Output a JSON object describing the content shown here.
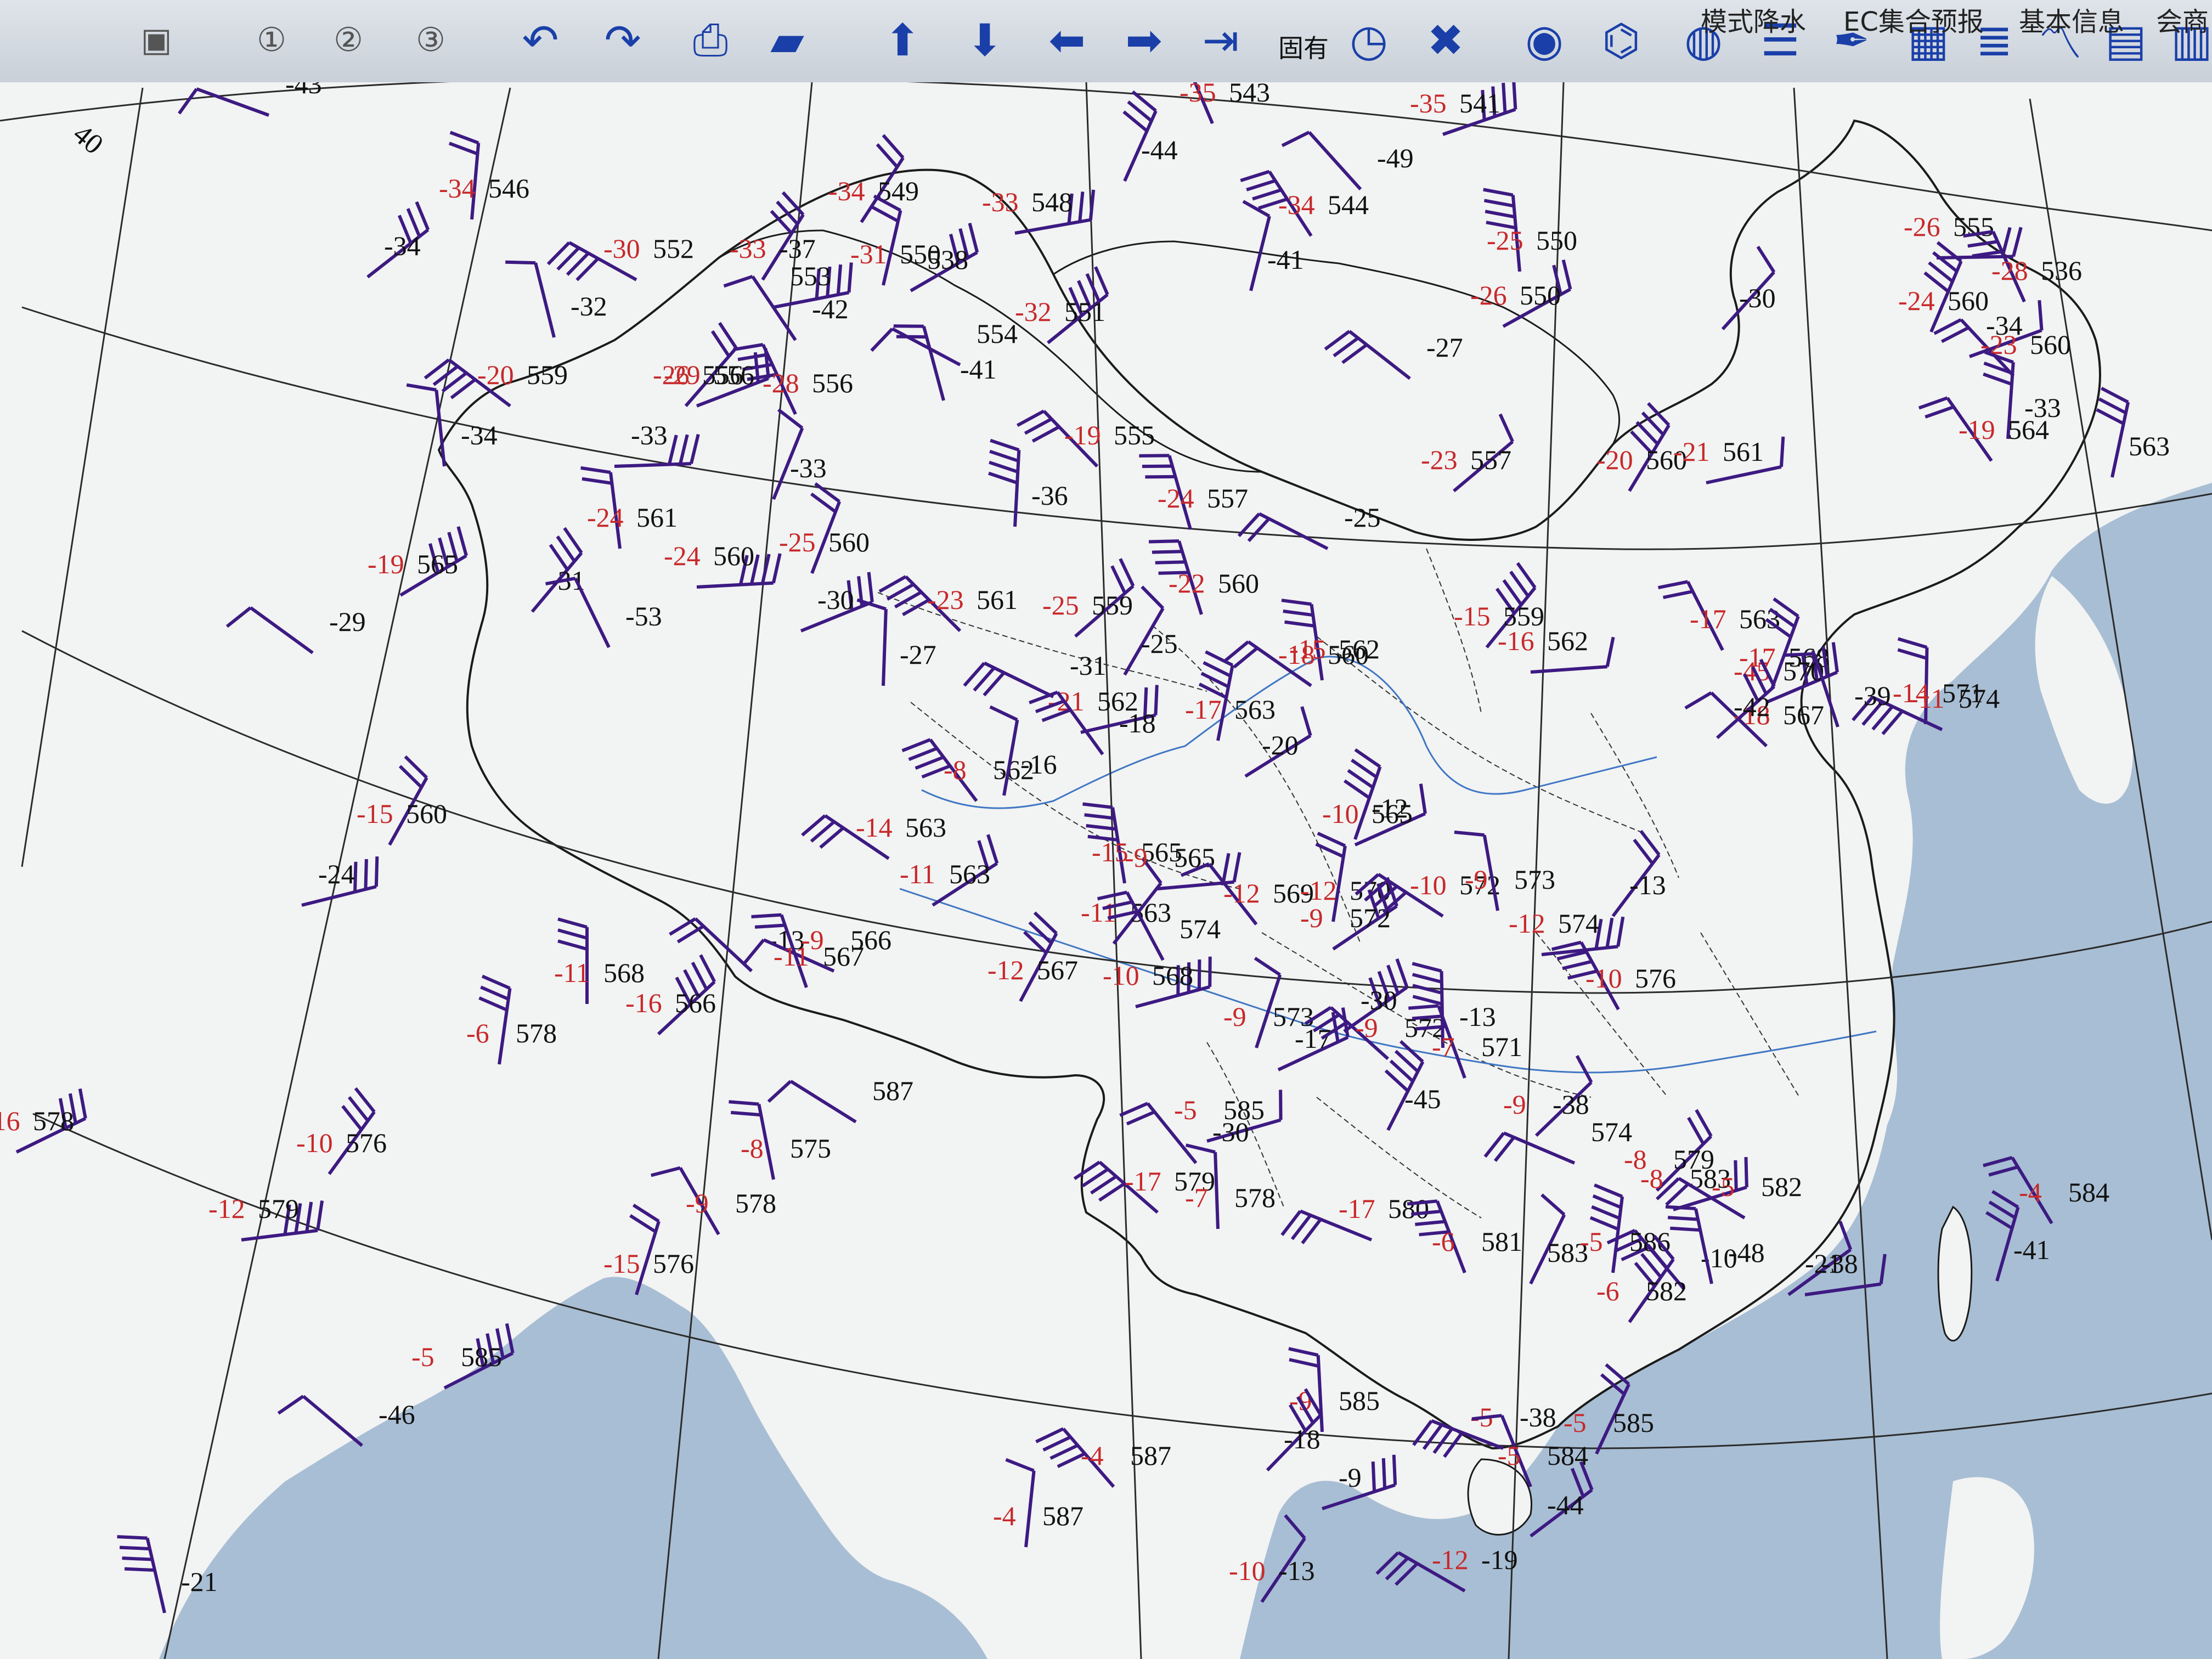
{
  "toolbar": {
    "fixed_label": "固有",
    "menu_items": [
      "模式降水",
      "EC集合预报",
      "基本信息",
      "会商"
    ],
    "buttons": [
      {
        "name": "nav-1-button",
        "glyph": "▣"
      },
      {
        "name": "nav-2-button",
        "glyph": "①"
      },
      {
        "name": "nav-3-button",
        "glyph": "②"
      },
      {
        "name": "nav-4-button",
        "glyph": "③"
      },
      {
        "name": "undo-icon",
        "glyph": "↶"
      },
      {
        "name": "redo-icon",
        "glyph": "↷"
      },
      {
        "name": "print-icon",
        "glyph": "⎙"
      },
      {
        "name": "open-folder-icon",
        "glyph": "▰"
      },
      {
        "name": "arrow-up-icon",
        "glyph": "⬆"
      },
      {
        "name": "arrow-down-icon",
        "glyph": "⬇"
      },
      {
        "name": "arrow-left-icon",
        "glyph": "⬅"
      },
      {
        "name": "arrow-right-icon",
        "glyph": "➡"
      },
      {
        "name": "skip-end-icon",
        "glyph": "⇥"
      },
      {
        "name": "clock-icon",
        "glyph": "◷"
      },
      {
        "name": "close-icon",
        "glyph": "✖"
      },
      {
        "name": "radar-icon",
        "glyph": "◉"
      },
      {
        "name": "antenna-icon",
        "glyph": "⌬"
      },
      {
        "name": "globe-icon",
        "glyph": "◍"
      },
      {
        "name": "layers-icon",
        "glyph": "☰"
      },
      {
        "name": "pen-icon",
        "glyph": "✒"
      },
      {
        "name": "table-icon",
        "glyph": "▦"
      },
      {
        "name": "chart-list-icon",
        "glyph": "≣"
      },
      {
        "name": "line-chart-icon",
        "glyph": "〽"
      },
      {
        "name": "calculator-icon",
        "glyph": "▤"
      },
      {
        "name": "meteogram-icon",
        "glyph": "▥"
      }
    ]
  },
  "map": {
    "colors": {
      "land": "#f2f3f3",
      "sea": "#a8bed4",
      "border": "#1b1b1b",
      "river": "#3f77c4",
      "barb": "#3d1a82",
      "temp": "#c8282a",
      "label": "#111111",
      "grid": "#2b2b2b"
    },
    "grid_labels": [
      "40"
    ],
    "stations": [
      {
        "h": "-43",
        "td": ""
      },
      {
        "h": "543",
        "td": "-35"
      },
      {
        "h": "-44",
        "td": ""
      },
      {
        "h": "541",
        "td": "-35"
      },
      {
        "h": "-49",
        "td": ""
      },
      {
        "h": "546",
        "td": "-34"
      },
      {
        "h": "-34",
        "td": ""
      },
      {
        "h": "552",
        "td": "-30"
      },
      {
        "h": "-32",
        "td": ""
      },
      {
        "h": "549",
        "td": "-34"
      },
      {
        "h": "548",
        "td": "-33"
      },
      {
        "h": "544",
        "td": "-34"
      },
      {
        "h": "-41",
        "td": ""
      },
      {
        "h": "550",
        "td": "-26"
      },
      {
        "h": "-27",
        "td": ""
      },
      {
        "h": "550",
        "td": "-25"
      },
      {
        "h": "-30",
        "td": ""
      },
      {
        "h": "555",
        "td": "-26"
      },
      {
        "h": "536",
        "td": "-28"
      },
      {
        "h": "560",
        "td": "-24"
      },
      {
        "h": "-34",
        "td": ""
      },
      {
        "h": "560",
        "td": "-23"
      },
      {
        "h": "-33",
        "td": ""
      },
      {
        "h": "551",
        "td": "-32"
      },
      {
        "h": "554",
        "td": ""
      },
      {
        "h": "-41",
        "td": ""
      },
      {
        "h": "-37",
        "td": "-33"
      },
      {
        "h": "553",
        "td": ""
      },
      {
        "h": "-42",
        "td": ""
      },
      {
        "h": "550",
        "td": "-31"
      },
      {
        "h": "538",
        "td": ""
      },
      {
        "h": "559",
        "td": "-20"
      },
      {
        "h": "-34",
        "td": ""
      },
      {
        "h": "556",
        "td": "-26"
      },
      {
        "h": "-33",
        "td": ""
      },
      {
        "h": "556",
        "td": "-28"
      },
      {
        "h": "-33",
        "td": ""
      },
      {
        "h": "556",
        "td": "-29"
      },
      {
        "h": "555",
        "td": "-19"
      },
      {
        "h": "-36",
        "td": ""
      },
      {
        "h": "557",
        "td": "-23"
      },
      {
        "h": "-25",
        "td": ""
      },
      {
        "h": "557",
        "td": "-24"
      },
      {
        "h": "560",
        "td": "-20"
      },
      {
        "h": "561",
        "td": "-21"
      },
      {
        "h": "564",
        "td": "-19"
      },
      {
        "h": "563",
        "td": ""
      },
      {
        "h": "565",
        "td": "-19"
      },
      {
        "h": "-29",
        "td": ""
      },
      {
        "h": "561",
        "td": "-24"
      },
      {
        "h": "-31",
        "td": ""
      },
      {
        "h": "560",
        "td": "-24"
      },
      {
        "h": "-53",
        "td": ""
      },
      {
        "h": "560",
        "td": "-25"
      },
      {
        "h": "-30",
        "td": ""
      },
      {
        "h": "561",
        "td": "-23"
      },
      {
        "h": "-27",
        "td": ""
      },
      {
        "h": "559",
        "td": "-25"
      },
      {
        "h": "-31",
        "td": ""
      },
      {
        "h": "560",
        "td": "-22"
      },
      {
        "h": "-25",
        "td": ""
      },
      {
        "h": "562",
        "td": "-21"
      },
      {
        "h": "-18",
        "td": ""
      },
      {
        "h": "563",
        "td": "-17"
      },
      {
        "h": "-20",
        "td": ""
      },
      {
        "h": "560",
        "td": "-18"
      },
      {
        "h": "562",
        "td": "-15"
      },
      {
        "h": "559",
        "td": "-15"
      },
      {
        "h": "562",
        "td": "-16"
      },
      {
        "h": "563",
        "td": "-17"
      },
      {
        "h": "568",
        "td": "-17"
      },
      {
        "h": "570",
        "td": "-45"
      },
      {
        "h": "567",
        "td": "-18"
      },
      {
        "h": "571",
        "td": "-14"
      },
      {
        "h": "-42",
        "td": ""
      },
      {
        "h": "574",
        "td": "-11"
      },
      {
        "h": "-39",
        "td": ""
      },
      {
        "h": "560",
        "td": "-15"
      },
      {
        "h": "-24",
        "td": ""
      },
      {
        "h": "562",
        "td": "-8"
      },
      {
        "h": "-16",
        "td": ""
      },
      {
        "h": "563",
        "td": "-11"
      },
      {
        "h": "563",
        "td": "-14"
      },
      {
        "h": "565",
        "td": "-15"
      },
      {
        "h": "563",
        "td": "-11"
      },
      {
        "h": "565",
        "td": "-9"
      },
      {
        "h": "574",
        "td": ""
      },
      {
        "h": "-12",
        "td": ""
      },
      {
        "h": "565",
        "td": "-10"
      },
      {
        "h": "-13",
        "td": ""
      },
      {
        "h": "568",
        "td": "-11"
      },
      {
        "h": "566",
        "td": "-16"
      },
      {
        "h": "566",
        "td": "-9"
      },
      {
        "h": "567",
        "td": "-11"
      },
      {
        "h": "567",
        "td": "-12"
      },
      {
        "h": "568",
        "td": "-10"
      },
      {
        "h": "569",
        "td": "-12"
      },
      {
        "h": "570",
        "td": "-12"
      },
      {
        "h": "572",
        "td": "-9"
      },
      {
        "h": "572",
        "td": "-10"
      },
      {
        "h": "573",
        "td": "-9"
      },
      {
        "h": "-13",
        "td": ""
      },
      {
        "h": "574",
        "td": "-12"
      },
      {
        "h": "576",
        "td": "-10"
      },
      {
        "h": "573",
        "td": "-9"
      },
      {
        "h": "-17",
        "td": ""
      },
      {
        "h": "572",
        "td": "-9"
      },
      {
        "h": "-13",
        "td": ""
      },
      {
        "h": "-38",
        "td": "-9"
      },
      {
        "h": "574",
        "td": ""
      },
      {
        "h": "571",
        "td": "-7"
      },
      {
        "h": "-45",
        "td": ""
      },
      {
        "h": "585",
        "td": "-5"
      },
      {
        "h": "-30",
        "td": ""
      },
      {
        "h": "578",
        "td": "-6"
      },
      {
        "h": "-30",
        "td": ""
      },
      {
        "h": "587",
        "td": ""
      },
      {
        "h": "575",
        "td": "-8"
      },
      {
        "h": "576",
        "td": "-10"
      },
      {
        "h": "579",
        "td": "-12"
      },
      {
        "h": "578",
        "td": "-9"
      },
      {
        "h": "576",
        "td": "-15"
      },
      {
        "h": "578",
        "td": "-16"
      },
      {
        "h": "579",
        "td": "-17"
      },
      {
        "h": "578",
        "td": "-7"
      },
      {
        "h": "579",
        "td": "-8"
      },
      {
        "h": "580",
        "td": "-17"
      },
      {
        "h": "581",
        "td": "-6"
      },
      {
        "h": "583",
        "td": ""
      },
      {
        "h": "583",
        "td": "-8"
      },
      {
        "h": "-10",
        "td": ""
      },
      {
        "h": "586",
        "td": "-5"
      },
      {
        "h": "-21",
        "td": ""
      },
      {
        "h": "582",
        "td": "-5"
      },
      {
        "h": "-48",
        "td": ""
      },
      {
        "h": "582",
        "td": "-6"
      },
      {
        "h": "-38",
        "td": ""
      },
      {
        "h": "584",
        "td": "-4"
      },
      {
        "h": "-41",
        "td": ""
      },
      {
        "h": "585",
        "td": "-5"
      },
      {
        "h": "-46",
        "td": ""
      },
      {
        "h": "585",
        "td": "-9"
      },
      {
        "h": "-18",
        "td": ""
      },
      {
        "h": "-38",
        "td": "-5"
      },
      {
        "h": "584",
        "td": "-5"
      },
      {
        "h": "585",
        "td": "-5"
      },
      {
        "h": "-9",
        "td": ""
      },
      {
        "h": "587",
        "td": "-4"
      },
      {
        "h": "587",
        "td": "-4"
      },
      {
        "h": "-44",
        "td": ""
      },
      {
        "h": "-19",
        "td": "-12"
      },
      {
        "h": "-21",
        "td": ""
      },
      {
        "h": "-13",
        "td": "-10"
      }
    ]
  }
}
